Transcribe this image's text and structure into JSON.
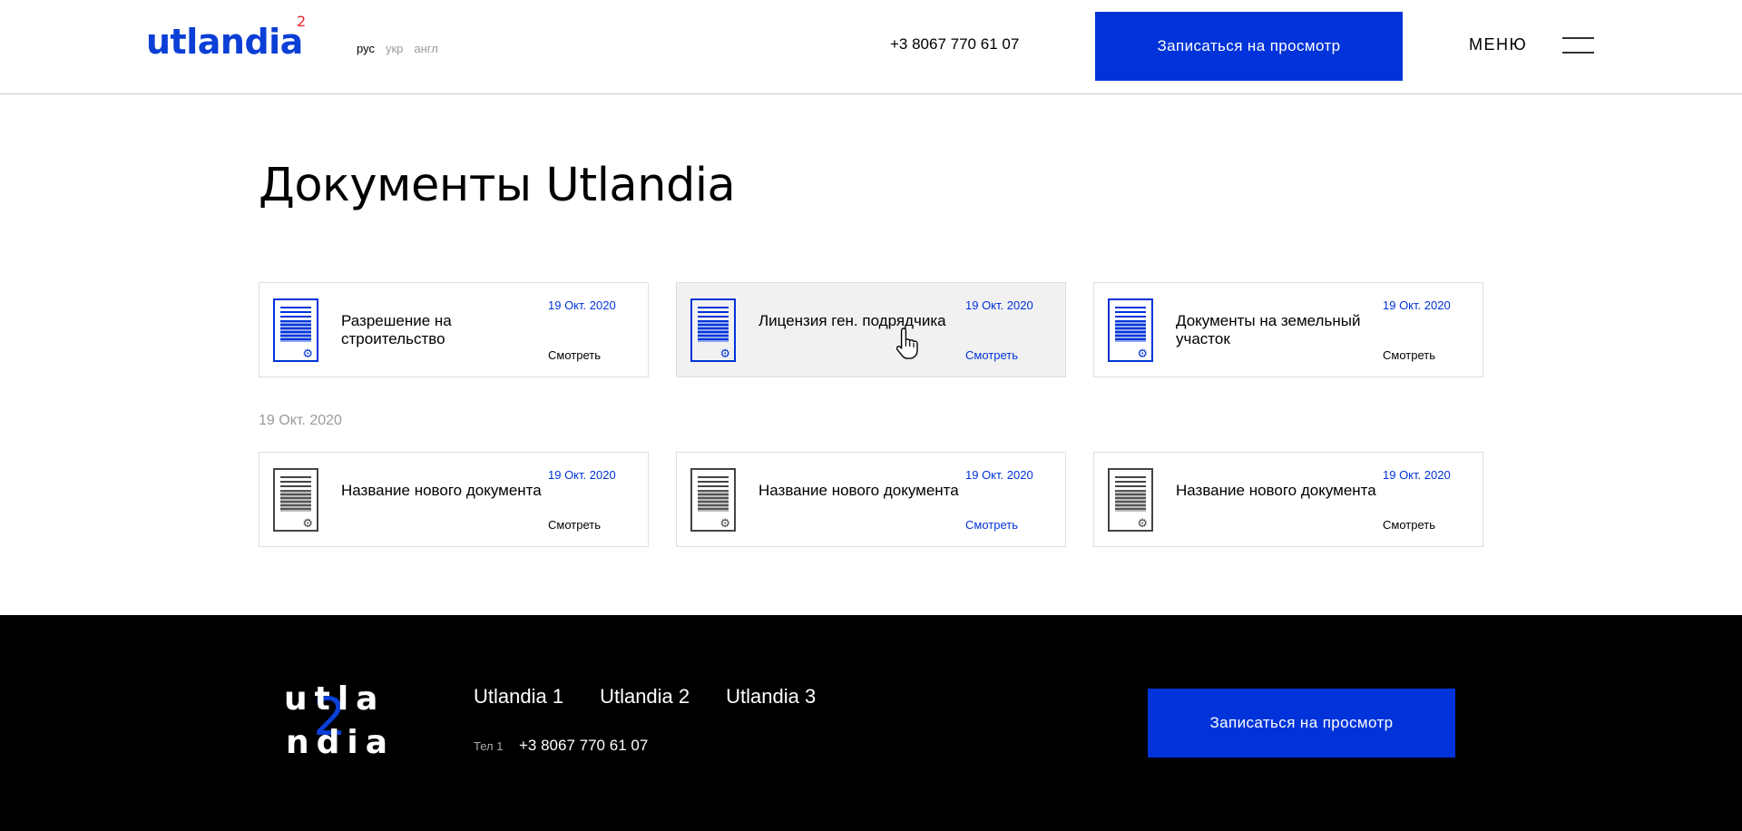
{
  "header": {
    "logo_text": "utlandia",
    "logo_sup": "2",
    "languages": [
      "рус",
      "укр",
      "англ"
    ],
    "phone": "+3 8067 770 61 07",
    "cta_label": "Записаться на просмотр",
    "menu_label": "МЕНЮ"
  },
  "main": {
    "title": "Документы Utlandia",
    "group_date": "19 Окт. 2020",
    "cards": [
      {
        "name": "Разрешение на строительство",
        "date": "19 Окт. 2020",
        "action": "Смотреть"
      },
      {
        "name": "Лицензия ген. подрядчика",
        "date": "19 Окт. 2020",
        "action": "Смотреть"
      },
      {
        "name": "Документы на земельный участок",
        "date": "19 Окт. 2020",
        "action": "Смотреть"
      },
      {
        "name": "Название нового документа",
        "date": "19 Окт. 2020",
        "action": "Смотреть"
      },
      {
        "name": "Название нового документа",
        "date": "19 Окт. 2020",
        "action": "Смотреть"
      },
      {
        "name": "Название нового документа",
        "date": "19 Окт. 2020",
        "action": "Смотреть"
      }
    ]
  },
  "footer": {
    "logo_row1": "utla",
    "logo_row2": "ndia",
    "logo_num": "2",
    "nav": [
      "Utlandia 1",
      "Utlandia 2",
      "Utlandia 3"
    ],
    "tel_label": "Тел 1",
    "tel": "+3 8067 770 61 07",
    "cta_label": "Записаться на просмотр"
  },
  "colors": {
    "accent": "#0033d9",
    "logo_sup": "#e3262b",
    "footer_bg": "#000000"
  }
}
